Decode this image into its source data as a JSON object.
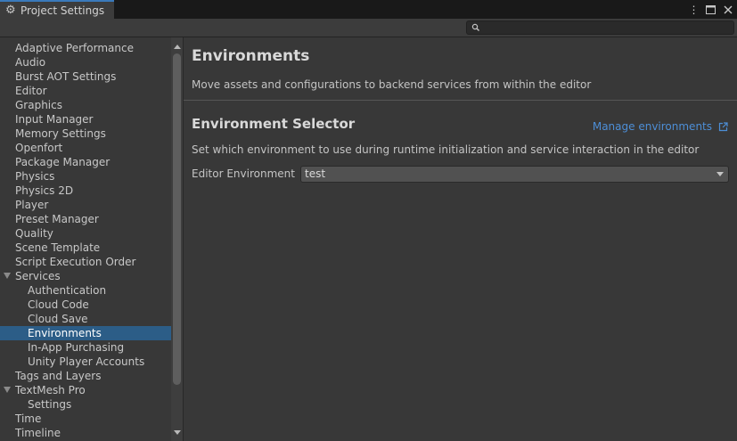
{
  "window": {
    "tab_title": "Project Settings",
    "tab_icon": "gear-icon",
    "controls": [
      "more-icon",
      "maximize-icon",
      "close-icon"
    ]
  },
  "search": {
    "placeholder": "",
    "value": ""
  },
  "sidebar": {
    "items": [
      {
        "label": "Adaptive Performance",
        "level": 0
      },
      {
        "label": "Audio",
        "level": 0
      },
      {
        "label": "Burst AOT Settings",
        "level": 0
      },
      {
        "label": "Editor",
        "level": 0
      },
      {
        "label": "Graphics",
        "level": 0
      },
      {
        "label": "Input Manager",
        "level": 0
      },
      {
        "label": "Memory Settings",
        "level": 0
      },
      {
        "label": "Openfort",
        "level": 0
      },
      {
        "label": "Package Manager",
        "level": 0
      },
      {
        "label": "Physics",
        "level": 0
      },
      {
        "label": "Physics 2D",
        "level": 0
      },
      {
        "label": "Player",
        "level": 0
      },
      {
        "label": "Preset Manager",
        "level": 0
      },
      {
        "label": "Quality",
        "level": 0
      },
      {
        "label": "Scene Template",
        "level": 0
      },
      {
        "label": "Script Execution Order",
        "level": 0
      },
      {
        "label": "Services",
        "level": 0,
        "expanded": true
      },
      {
        "label": "Authentication",
        "level": 1
      },
      {
        "label": "Cloud Code",
        "level": 1
      },
      {
        "label": "Cloud Save",
        "level": 1
      },
      {
        "label": "Environments",
        "level": 1,
        "selected": true
      },
      {
        "label": "In-App Purchasing",
        "level": 1
      },
      {
        "label": "Unity Player Accounts",
        "level": 1
      },
      {
        "label": "Tags and Layers",
        "level": 0
      },
      {
        "label": "TextMesh Pro",
        "level": 0,
        "expanded": true
      },
      {
        "label": "Settings",
        "level": 1
      },
      {
        "label": "Time",
        "level": 0
      },
      {
        "label": "Timeline",
        "level": 0
      }
    ]
  },
  "main": {
    "title": "Environments",
    "description": "Move assets and configurations to backend services from within the editor",
    "selector": {
      "heading": "Environment Selector",
      "manage_link": "Manage environments",
      "description": "Set which environment to use during runtime initialization and service interaction in the editor",
      "field_label": "Editor Environment",
      "field_value": "test"
    }
  },
  "colors": {
    "accent": "#2c5d87",
    "link": "#4d8ed6",
    "tab_highlight": "#3a79bb",
    "panel": "#383838"
  }
}
